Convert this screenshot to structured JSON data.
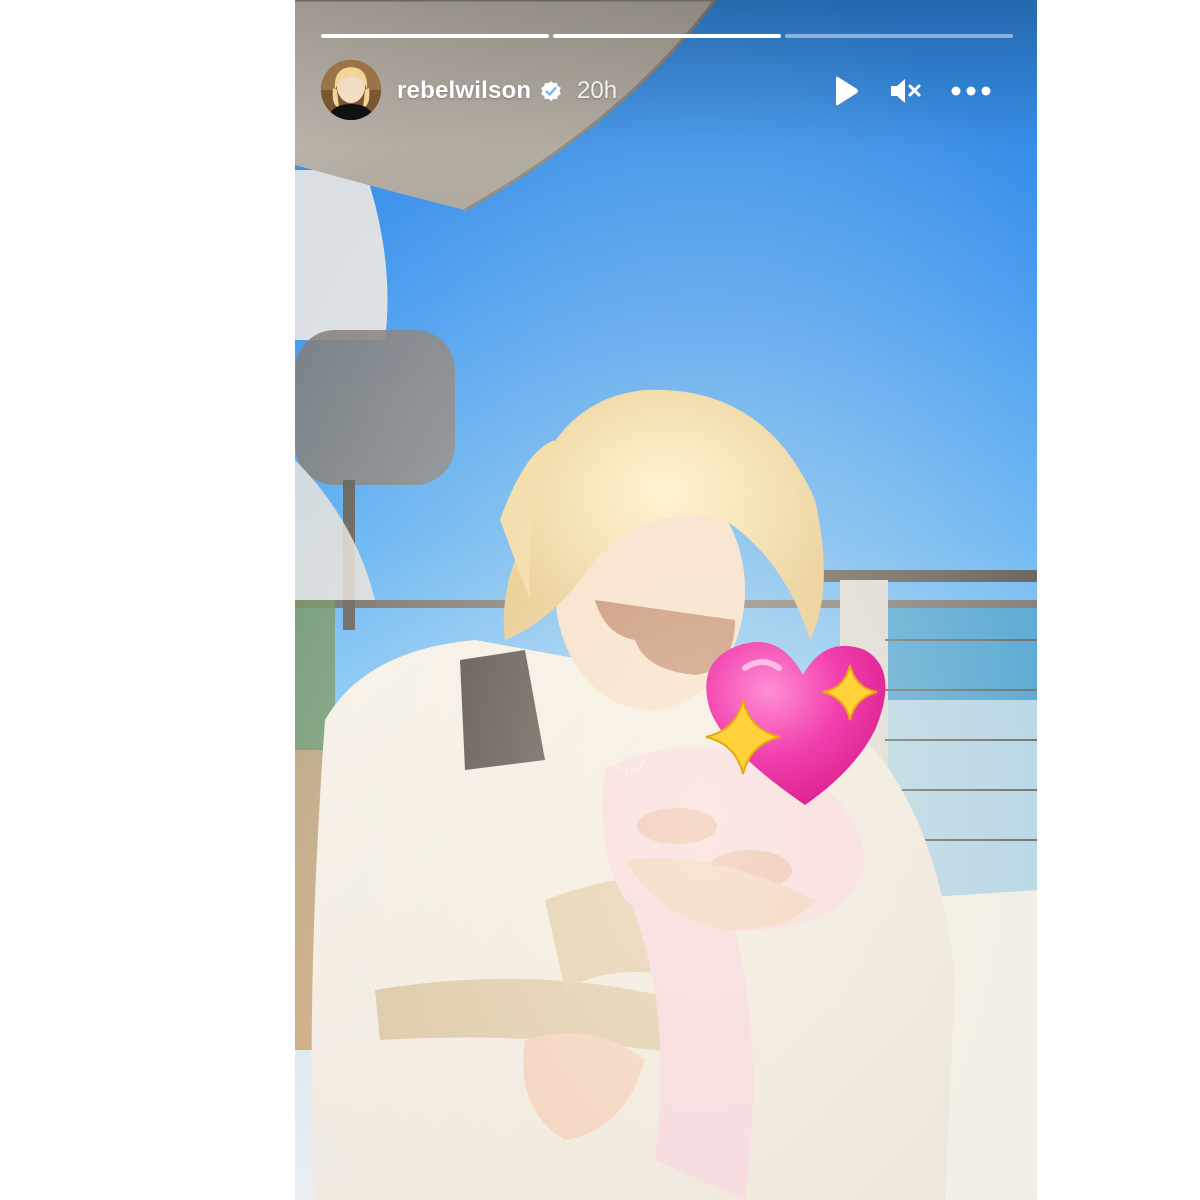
{
  "story": {
    "username": "rebelwilson",
    "time_ago": "20h",
    "verified": true,
    "progress": [
      {
        "state": "viewed"
      },
      {
        "state": "viewed"
      },
      {
        "state": "current",
        "fill": 0
      }
    ]
  },
  "icons": {
    "play": "play-icon",
    "mute": "muted-speaker-icon",
    "more": "more-options-icon",
    "verified": "verified-badge-icon"
  },
  "colors": {
    "sky": "#3f98f0",
    "sea": "#3a9ad0",
    "heart": "#f03aa8",
    "sparkle": "#ffd23a"
  }
}
